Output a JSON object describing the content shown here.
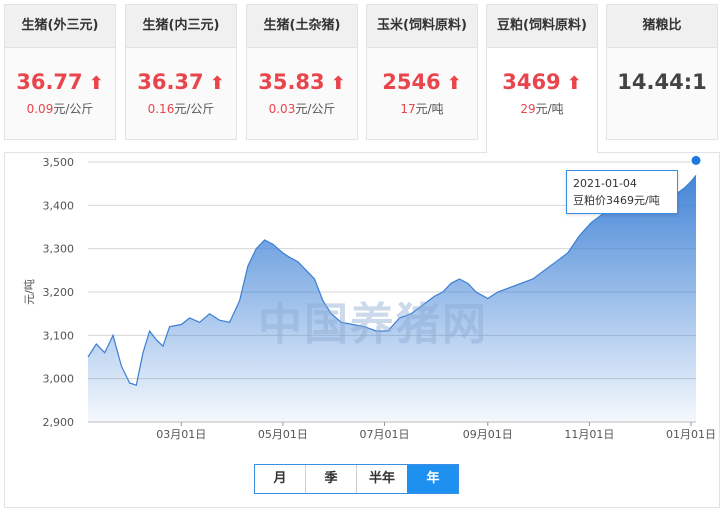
{
  "cards": [
    {
      "name": "生猪(外三元)",
      "price": "36.77",
      "change": "0.09",
      "unit": "元/公斤",
      "trend": "up"
    },
    {
      "name": "生猪(内三元)",
      "price": "36.37",
      "change": "0.16",
      "unit": "元/公斤",
      "trend": "up"
    },
    {
      "name": "生猪(土杂猪)",
      "price": "35.83",
      "change": "0.03",
      "unit": "元/公斤",
      "trend": "up"
    },
    {
      "name": "玉米(饲料原料)",
      "price": "2546",
      "change": "17",
      "unit": "元/吨",
      "trend": "up"
    },
    {
      "name": "豆粕(饲料原料)",
      "price": "3469",
      "change": "29",
      "unit": "元/吨",
      "trend": "up"
    },
    {
      "name": "猪粮比",
      "ratio": "14.44:1"
    }
  ],
  "arrow_glyph": "⬆",
  "watermark": "中国养猪网",
  "tooltip": {
    "date": "2021-01-04",
    "label": "豆粕价3469元/吨"
  },
  "tabs": [
    "月",
    "季",
    "半年",
    "年"
  ],
  "active_tab": "年",
  "colors": {
    "up": "#e8454d",
    "line": "#3a7fd5",
    "tab_active": "#1e90f0"
  },
  "chart_data": {
    "type": "area",
    "title": "",
    "xlabel": "",
    "ylabel": "元/吨",
    "ylim": [
      2900,
      3500
    ],
    "yticks": [
      2900,
      3000,
      3100,
      3200,
      3300,
      3400,
      3500
    ],
    "xtick_labels": [
      "03月01日",
      "05月01日",
      "07月01日",
      "09月01日",
      "11月01日",
      "01月01日"
    ],
    "xtick_dates": [
      "2020-03-01",
      "2020-05-01",
      "2020-07-01",
      "2020-09-01",
      "2020-11-01",
      "2021-01-01"
    ],
    "x_range": [
      "2020-01-05",
      "2021-01-04"
    ],
    "grid": true,
    "series": [
      {
        "color": "#3a7fd5",
        "points": [
          [
            "2020-01-05",
            3050
          ],
          [
            "2020-01-10",
            3080
          ],
          [
            "2020-01-15",
            3060
          ],
          [
            "2020-01-20",
            3100
          ],
          [
            "2020-01-25",
            3030
          ],
          [
            "2020-01-30",
            2990
          ],
          [
            "2020-02-03",
            2985
          ],
          [
            "2020-02-07",
            3060
          ],
          [
            "2020-02-11",
            3110
          ],
          [
            "2020-02-15",
            3090
          ],
          [
            "2020-02-19",
            3075
          ],
          [
            "2020-02-23",
            3120
          ],
          [
            "2020-03-01",
            3125
          ],
          [
            "2020-03-06",
            3140
          ],
          [
            "2020-03-12",
            3130
          ],
          [
            "2020-03-18",
            3150
          ],
          [
            "2020-03-24",
            3135
          ],
          [
            "2020-03-30",
            3130
          ],
          [
            "2020-04-05",
            3180
          ],
          [
            "2020-04-10",
            3260
          ],
          [
            "2020-04-15",
            3300
          ],
          [
            "2020-04-20",
            3320
          ],
          [
            "2020-04-25",
            3310
          ],
          [
            "2020-05-01",
            3290
          ],
          [
            "2020-05-05",
            3280
          ],
          [
            "2020-05-10",
            3270
          ],
          [
            "2020-05-15",
            3250
          ],
          [
            "2020-05-20",
            3230
          ],
          [
            "2020-05-25",
            3180
          ],
          [
            "2020-05-30",
            3150
          ],
          [
            "2020-06-05",
            3130
          ],
          [
            "2020-06-12",
            3125
          ],
          [
            "2020-06-19",
            3120
          ],
          [
            "2020-06-26",
            3110
          ],
          [
            "2020-07-03",
            3110
          ],
          [
            "2020-07-10",
            3140
          ],
          [
            "2020-07-17",
            3150
          ],
          [
            "2020-07-24",
            3170
          ],
          [
            "2020-07-31",
            3190
          ],
          [
            "2020-08-05",
            3200
          ],
          [
            "2020-08-10",
            3220
          ],
          [
            "2020-08-15",
            3230
          ],
          [
            "2020-08-20",
            3220
          ],
          [
            "2020-08-25",
            3200
          ],
          [
            "2020-09-01",
            3185
          ],
          [
            "2020-09-07",
            3200
          ],
          [
            "2020-09-14",
            3210
          ],
          [
            "2020-09-21",
            3220
          ],
          [
            "2020-09-28",
            3230
          ],
          [
            "2020-10-05",
            3250
          ],
          [
            "2020-10-12",
            3270
          ],
          [
            "2020-10-19",
            3290
          ],
          [
            "2020-10-26",
            3330
          ],
          [
            "2020-11-02",
            3360
          ],
          [
            "2020-11-09",
            3380
          ],
          [
            "2020-11-16",
            3390
          ],
          [
            "2020-11-23",
            3400
          ],
          [
            "2020-11-30",
            3405
          ],
          [
            "2020-12-07",
            3405
          ],
          [
            "2020-12-14",
            3410
          ],
          [
            "2020-12-21",
            3420
          ],
          [
            "2020-12-28",
            3440
          ],
          [
            "2021-01-01",
            3455
          ],
          [
            "2021-01-04",
            3469
          ]
        ]
      }
    ]
  }
}
